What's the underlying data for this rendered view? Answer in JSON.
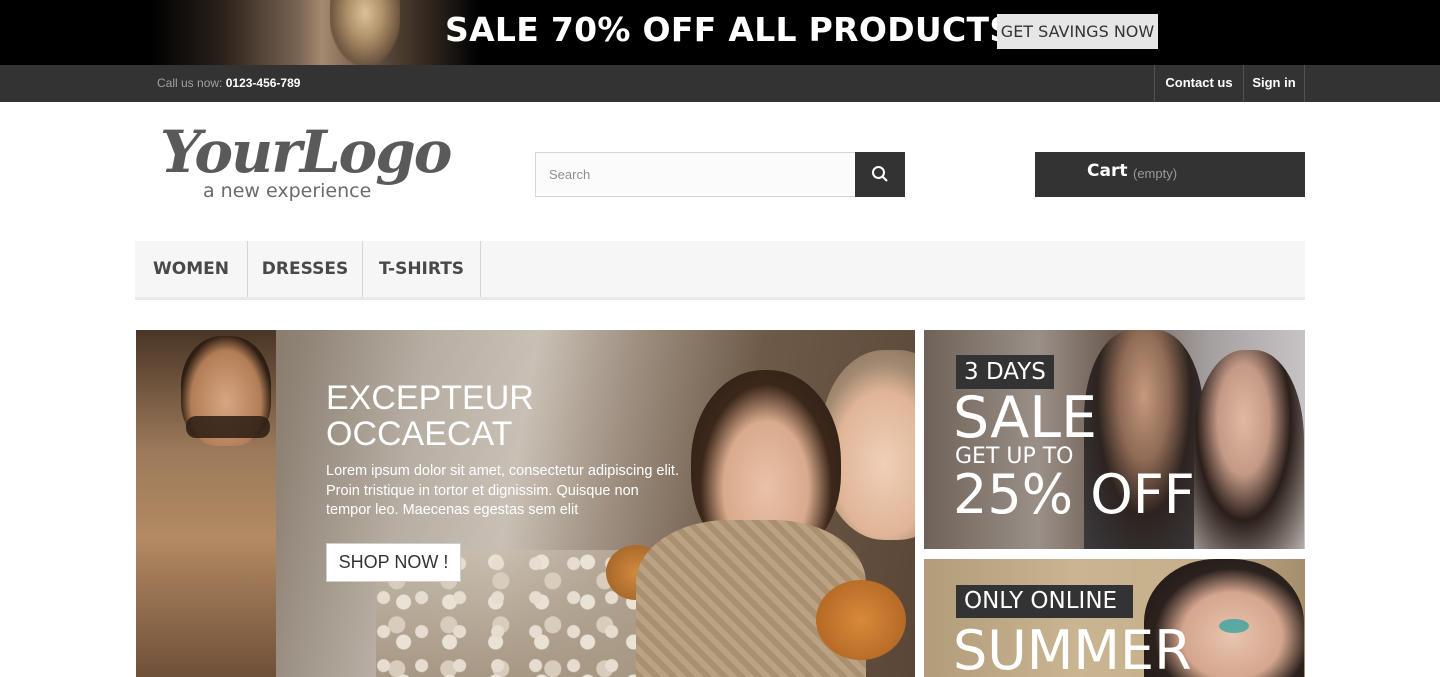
{
  "promo": {
    "headline": "SALE 70% OFF ALL PRODUCTS",
    "button_label": "GET SAVINGS NOW"
  },
  "topnav": {
    "call_label": "Call us now:",
    "phone": "0123-456-789",
    "contact_label": "Contact us",
    "signin_label": "Sign in"
  },
  "logo": {
    "main": "YourLogo",
    "tagline": "a new experience"
  },
  "search": {
    "placeholder": "Search"
  },
  "cart": {
    "label": "Cart",
    "status": "(empty)"
  },
  "menu": {
    "items": [
      {
        "label": "WOMEN"
      },
      {
        "label": "DRESSES"
      },
      {
        "label": "T-SHIRTS"
      }
    ]
  },
  "slider": {
    "title": "EXCEPTEUR OCCAECAT",
    "text": "Lorem ipsum dolor sit amet, consectetur adipiscing elit. Proin tristique in tortor et dignissim. Quisque non tempor leo. Maecenas egestas sem elit",
    "button_label": "SHOP NOW !"
  },
  "banners": [
    {
      "tag": "3 DAYS",
      "headline": "SALE",
      "sub": "GET UP TO",
      "offer": "25% OFF"
    },
    {
      "tag": "ONLY ONLINE",
      "headline": "SUMMER"
    }
  ],
  "colors": {
    "dark": "#333333",
    "promo_bg": "#000000",
    "menu_bg": "#f6f6f6"
  }
}
